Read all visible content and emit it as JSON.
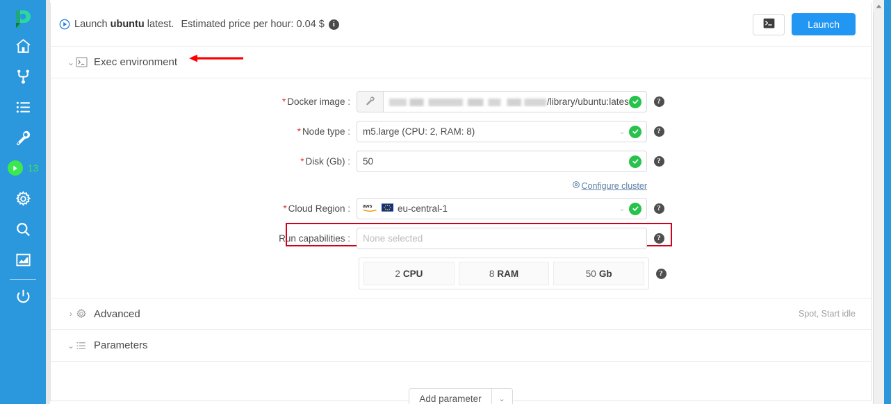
{
  "sidebar": {
    "logo_name": "cloud-pipeline-logo",
    "items": [
      {
        "name": "home-icon",
        "label": "Home"
      },
      {
        "name": "pipelines-icon",
        "label": "Pipelines"
      },
      {
        "name": "library-icon",
        "label": "Library"
      },
      {
        "name": "tools-icon",
        "label": "Tools"
      },
      {
        "name": "runs-icon",
        "label": "Runs"
      },
      {
        "name": "settings-icon",
        "label": "Settings"
      },
      {
        "name": "search-icon",
        "label": "Search"
      },
      {
        "name": "billing-icon",
        "label": "Billing"
      },
      {
        "name": "logout-icon",
        "label": "Log out"
      }
    ],
    "runs_count": "13"
  },
  "header": {
    "title_prefix": "Launch ",
    "title_bold": "ubuntu",
    "title_suffix": " latest.",
    "price_text": "Estimated price per hour: 0.04 $",
    "info_badge": "i",
    "terminal_button_label": "terminal",
    "launch_label": "Launch"
  },
  "sections": {
    "exec_environment": {
      "label": "Exec environment",
      "chevron": "⌄",
      "icon": "terminal-icon"
    },
    "advanced": {
      "label": "Advanced",
      "chevron": "›",
      "icon": "gear-icon",
      "summary": "Spot,  Start idle"
    },
    "parameters": {
      "label": "Parameters",
      "chevron": "⌄",
      "icon": "list-icon"
    }
  },
  "form": {
    "docker_image": {
      "label": "Docker image",
      "required": true,
      "prefix_masked": "",
      "value": "/library/ubuntu:latest",
      "addon_icon": "wrench-icon",
      "valid": true
    },
    "node_type": {
      "label": "Node type",
      "required": true,
      "value": "m5.large (CPU: 2, RAM: 8)",
      "valid": true
    },
    "disk": {
      "label": "Disk (Gb)",
      "required": true,
      "value": "50",
      "valid": true
    },
    "configure_cluster": {
      "label": "Configure cluster",
      "icon": "cluster-icon"
    },
    "cloud_region": {
      "label": "Cloud Region",
      "required": true,
      "value": "eu-central-1",
      "provider_icon": "aws-icon",
      "flag_icon": "eu-flag-icon",
      "valid": true
    },
    "run_capabilities": {
      "label": "Run capabilities",
      "required": false,
      "placeholder": "None selected",
      "value": "",
      "highlighted": true,
      "highlight_color": "#d0021b"
    },
    "spec_boxes": [
      {
        "value": "2",
        "unit": "CPU"
      },
      {
        "value": "8",
        "unit": "RAM"
      },
      {
        "value": "50",
        "unit": "Gb"
      }
    ]
  },
  "footer": {
    "add_parameter_label": "Add parameter",
    "add_parameter_caret": "⌄"
  },
  "annotation": {
    "arrow_name": "red-pointer-arrow",
    "color": "#ff0000"
  },
  "colors": {
    "sidebar": "#2b97dc",
    "accent": "#2196f3",
    "ok": "#27c24c",
    "runs_green": "#3ce84f",
    "required": "#e5342c"
  }
}
